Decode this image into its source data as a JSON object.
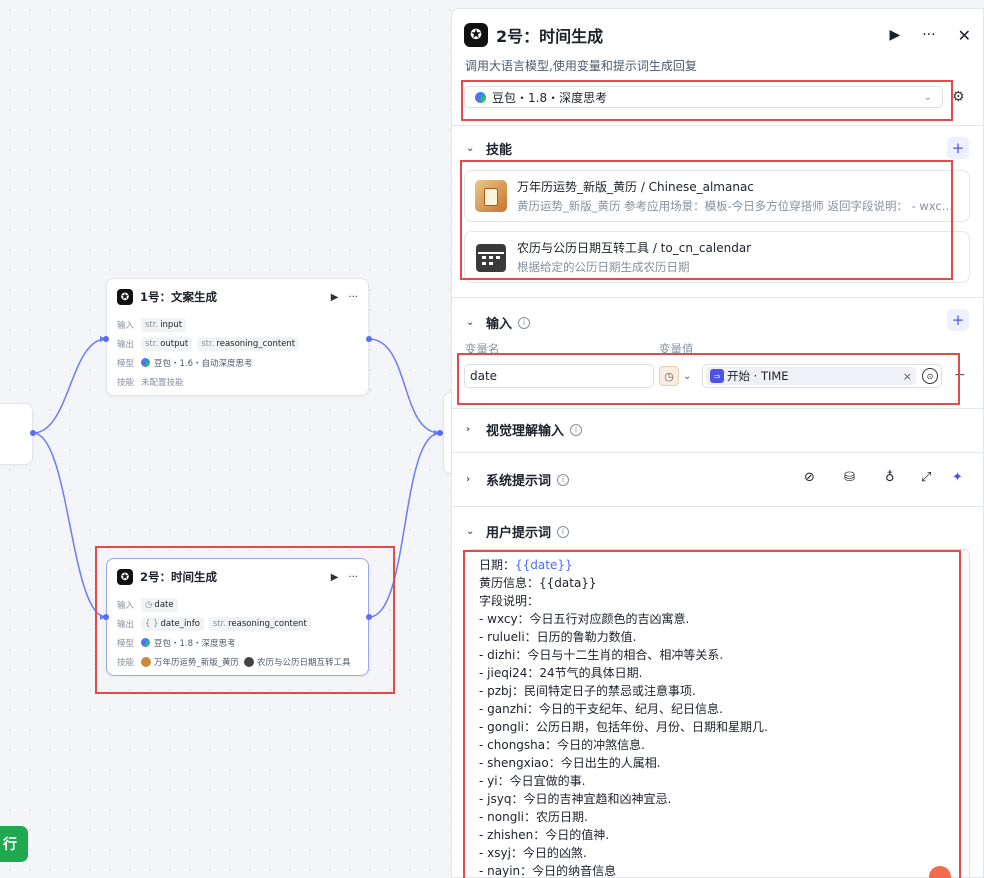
{
  "canvas": {
    "run_button_label": "行",
    "node1": {
      "title": "1号：文案生成",
      "input_label": "输入",
      "input_type": "str.",
      "input_var": "input",
      "output_label": "输出",
      "output_var1_type": "str.",
      "output_var1": "output",
      "output_var2_type": "str.",
      "output_var2": "reasoning_content",
      "model_label": "模型",
      "model_value": "豆包・1.6・自动深度思考",
      "skill_label": "技能",
      "skill_value": "未配置技能"
    },
    "node2": {
      "title": "2号：时间生成",
      "input_label": "输入",
      "input_var": "date",
      "output_label": "输出",
      "output_var1_type": "{ }",
      "output_var1": "date_info",
      "output_var2_type": "str.",
      "output_var2": "reasoning_content",
      "model_label": "模型",
      "model_value": "豆包・1.8・深度思考",
      "skill_label": "技能",
      "skill1": "万年历运势_新版_黄历",
      "skill2": "农历与公历日期互转工具"
    }
  },
  "panel": {
    "title": "2号：时间生成",
    "description": "调用大语言模型,使用变量和提示词生成回复",
    "model": "豆包・1.8・深度思考",
    "skills_title": "技能",
    "skills": [
      {
        "name": "万年历运势_新版_黄历 / Chinese_almanac",
        "desc": "黄历运势_新版_黄历 参考应用场景：模板-今日多方位穿搭师 返回字段说明： - wxcy：今日五行对应颜色的吉凶寓意"
      },
      {
        "name": "农历与公历日期互转工具 / to_cn_calendar",
        "desc": "根据给定的公历日期生成农历日期"
      }
    ],
    "input_title": "输入",
    "col_var_name": "变量名",
    "col_var_value": "变量值",
    "input_var_name": "date",
    "input_var_ref": "开始 · TIME",
    "visual_title": "视觉理解输入",
    "system_prompt_title": "系统提示词",
    "user_prompt_title": "用户提示词",
    "prompt_lines": [
      {
        "pre": "日期：",
        "var": "{{date}}"
      },
      {
        "pre": "黄历信息：{{data}}",
        "var": ""
      },
      {
        "pre": "字段说明：",
        "var": ""
      },
      {
        "pre": "- wxcy：今日五行对应颜色的吉凶寓意.",
        "var": ""
      },
      {
        "pre": "- rulueli：日历的鲁勒力数值.",
        "var": ""
      },
      {
        "pre": "- dizhi：今日与十二生肖的相合、相冲等关系.",
        "var": ""
      },
      {
        "pre": "- jieqi24：24节气的具体日期.",
        "var": ""
      },
      {
        "pre": "- pzbj：民间特定日子的禁忌或注意事项.",
        "var": ""
      },
      {
        "pre": "- ganzhi：今日的干支纪年、纪月、纪日信息.",
        "var": ""
      },
      {
        "pre": "- gongli：公历日期，包括年份、月份、日期和星期几.",
        "var": ""
      },
      {
        "pre": "- chongsha：今日的冲煞信息.",
        "var": ""
      },
      {
        "pre": "- shengxiao：今日出生的人属相.",
        "var": ""
      },
      {
        "pre": "- yi：今日宜做的事.",
        "var": ""
      },
      {
        "pre": "- jsyq：今日的吉神宜趋和凶神宜忌.",
        "var": ""
      },
      {
        "pre": "- nongli：农历日期.",
        "var": ""
      },
      {
        "pre": "- zhishen：今日的值神.",
        "var": ""
      },
      {
        "pre": "- xsyj：今日的凶煞.",
        "var": ""
      },
      {
        "pre": "- nayin：今日的纳音信息",
        "var": ""
      }
    ]
  }
}
